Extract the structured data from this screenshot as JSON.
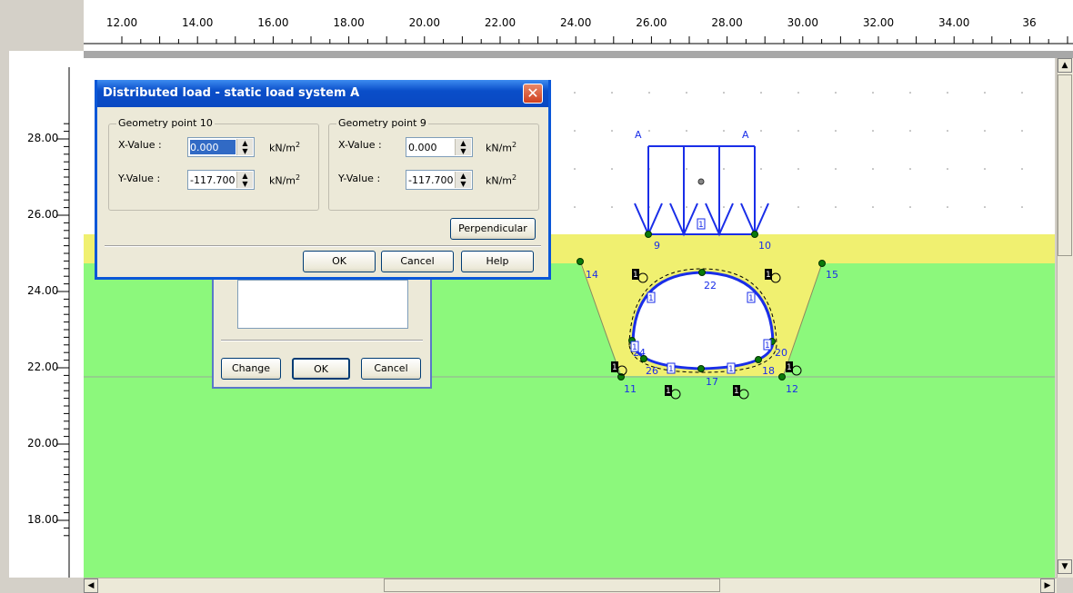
{
  "ruler": {
    "x_ticks": [
      "12.00",
      "14.00",
      "16.00",
      "18.00",
      "20.00",
      "22.00",
      "24.00",
      "26.00",
      "28.00",
      "30.00",
      "32.00",
      "34.00",
      "36"
    ],
    "y_ticks": [
      "28.00",
      "26.00",
      "24.00",
      "22.00",
      "20.00",
      "18.00"
    ]
  },
  "colors": {
    "soil_upper": "#f0f070",
    "soil_lower": "#8cf87c",
    "air": "#ffffff",
    "geometry": "#0000ff",
    "point": "#007700",
    "title_bar": "#0a4ec9"
  },
  "model": {
    "load_labels": [
      "A",
      "A"
    ],
    "point_labels": [
      "9",
      "10",
      "14",
      "15",
      "22",
      "24",
      "26",
      "17",
      "18",
      "20",
      "11",
      "12"
    ],
    "beam_markers": [
      "1",
      "1",
      "1",
      "1",
      "1",
      "1",
      "1"
    ],
    "support_markers": [
      "1",
      "1",
      "1",
      "1",
      "1",
      "1"
    ]
  },
  "dialog_load": {
    "title": "Distributed load - static load system A",
    "group_left": {
      "legend": "Geometry point 10",
      "x_label": "X-Value :",
      "x_value": "0.000",
      "y_label": "Y-Value :",
      "y_value": "-117.700",
      "unit": "kN/m",
      "unit_exp": "2"
    },
    "group_right": {
      "legend": "Geometry point 9",
      "x_label": "X-Value :",
      "x_value": "0.000",
      "y_label": "Y-Value :",
      "y_value": "-117.700",
      "unit": "kN/m",
      "unit_exp": "2"
    },
    "perpendicular_label": "Perpendicular",
    "ok_label": "OK",
    "cancel_label": "Cancel",
    "help_label": "Help"
  },
  "dialog_back": {
    "change_label": "Change",
    "ok_label": "OK",
    "cancel_label": "Cancel"
  }
}
